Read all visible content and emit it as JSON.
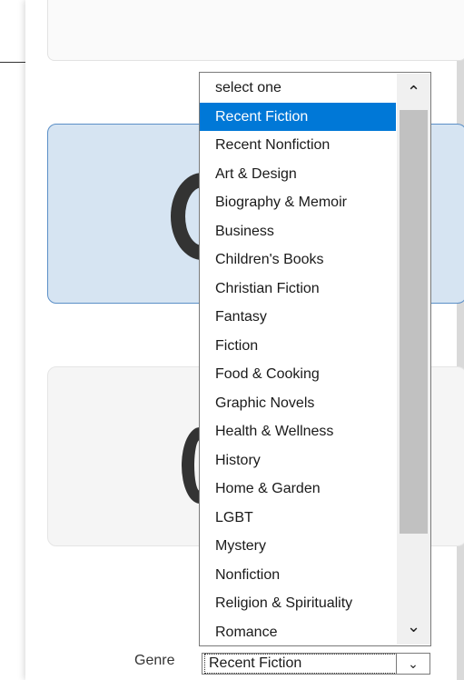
{
  "dropdown": {
    "options": [
      "select one",
      "Recent Fiction",
      "Recent Nonfiction",
      "Art & Design",
      "Biography & Memoir",
      "Business",
      "Children's Books",
      "Christian Fiction",
      "Fantasy",
      "Fiction",
      "Food & Cooking",
      "Graphic Novels",
      "Health & Wellness",
      "History",
      "Home & Garden",
      "LGBT",
      "Mystery",
      "Nonfiction",
      "Religion & Spirituality",
      "Romance"
    ],
    "selected_index": 1
  },
  "form": {
    "genre_label": "Genre",
    "genre_value": "Recent Fiction"
  },
  "icons": {
    "scroll_up": "chevron-up-icon",
    "scroll_down": "chevron-down-icon",
    "select_arrow": "chevron-down-icon"
  },
  "colors": {
    "selection": "#0078d7",
    "card_blue": "#d6e4f2",
    "card_border": "#5b8fc7",
    "indicator": "#e02020"
  }
}
